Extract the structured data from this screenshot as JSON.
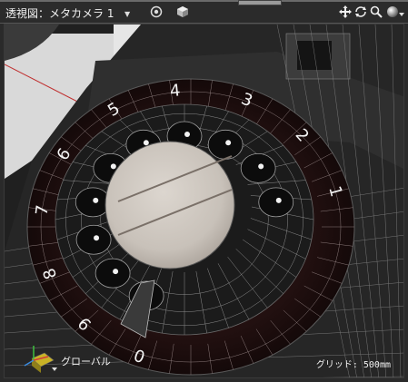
{
  "viewport": {
    "title": "透視図：メタカメラ 1",
    "mode_caret": "▼",
    "gizmo_label": "グローバル",
    "grid_label": "グリッド: 500mm"
  },
  "toolbar": {
    "icons": [
      "camera-target-icon",
      "object-cube-icon",
      "move-icon",
      "rotate-icon",
      "zoom-icon",
      "shading-sphere-icon"
    ]
  },
  "dial": {
    "digits": [
      "1",
      "2",
      "3",
      "4",
      "5",
      "6",
      "7",
      "8",
      "9",
      "0"
    ]
  },
  "colors": {
    "viewport_bg": "#202020",
    "accent_red": "#c03030",
    "wire": "#9a9a9a"
  }
}
